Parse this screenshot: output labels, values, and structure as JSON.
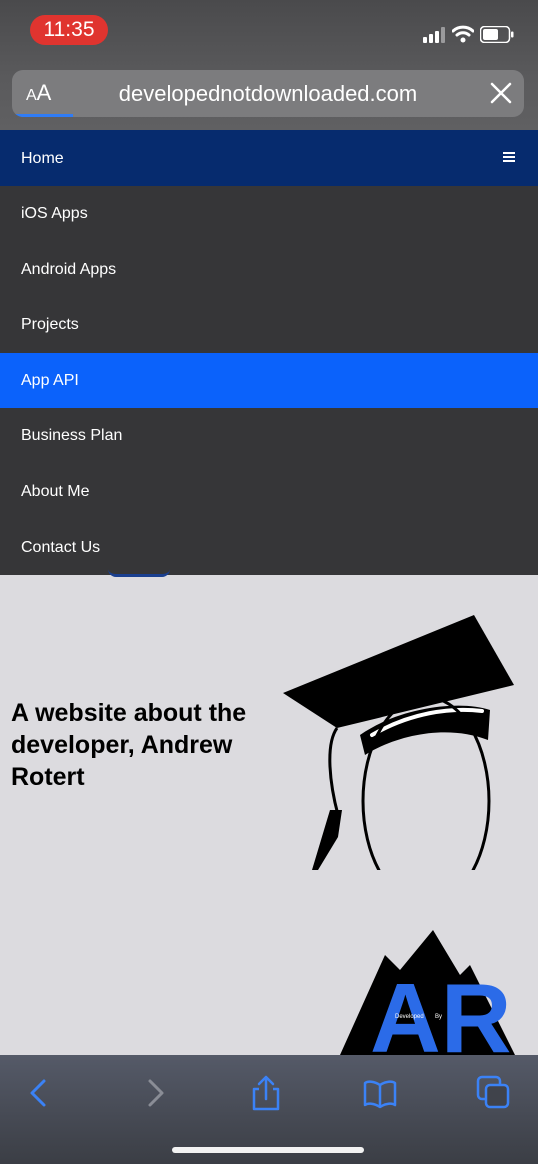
{
  "status_bar": {
    "time": "11:35",
    "icons": [
      "signal-icon",
      "wifi-icon",
      "battery-icon"
    ]
  },
  "browser": {
    "reader_button": {
      "small": "A",
      "large": "A"
    },
    "url": "developednotdownloaded.com",
    "close_icon": "close-icon",
    "page_load_progress": 0.12
  },
  "nav": {
    "home_label": "Home",
    "menu_icon": "hamburger-icon",
    "items": [
      {
        "label": "iOS Apps",
        "active": false
      },
      {
        "label": "Android Apps",
        "active": false
      },
      {
        "label": "Projects",
        "active": false
      },
      {
        "label": "App API",
        "active": true
      },
      {
        "label": "Business Plan",
        "active": false
      },
      {
        "label": "About Me",
        "active": false
      },
      {
        "label": "Contact Us",
        "active": false
      }
    ]
  },
  "main": {
    "headline": "A website about the developer, Andrew Rotert",
    "images": [
      "graduation-cap-illustration",
      "developer-logo"
    ],
    "logo_text": {
      "large": "AR",
      "small_left": "Developed",
      "small_right": "By"
    }
  },
  "toolbar": {
    "buttons": [
      "back-icon",
      "forward-icon",
      "share-icon",
      "bookmarks-icon",
      "tabs-icon"
    ]
  },
  "colors": {
    "nav_home_bg": "#062b6e",
    "menu_bg": "#363638",
    "active_item_bg": "#0b62fb",
    "time_pill_bg": "#e0342f",
    "page_bg": "#dcdbdf",
    "toolbar_icon": "#3b82f6"
  }
}
